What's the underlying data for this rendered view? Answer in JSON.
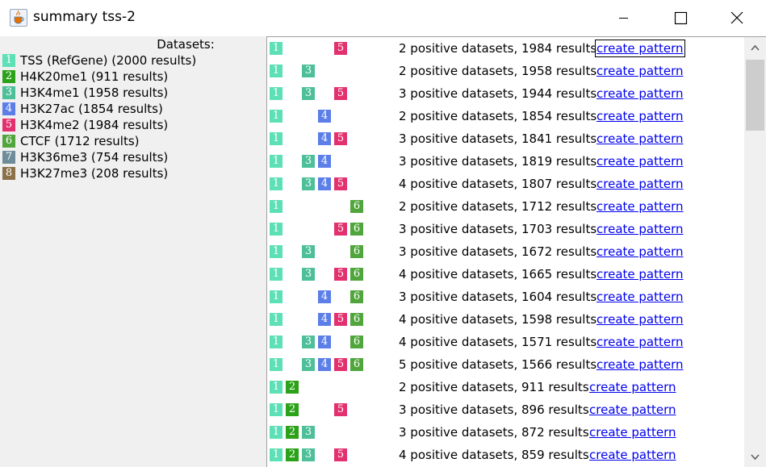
{
  "window": {
    "title": "summary tss-2",
    "icon": "java-cup-icon",
    "controls": {
      "minimize": "minimize-icon",
      "maximize": "maximize-icon",
      "close": "close-icon"
    }
  },
  "datasets": {
    "header": "Datasets:",
    "items": [
      {
        "num": "1",
        "label": "TSS (RefGene) (2000 results)",
        "color": "#5ee0b6"
      },
      {
        "num": "2",
        "label": "H4K20me1 (911 results)",
        "color": "#2ca21a"
      },
      {
        "num": "3",
        "label": "H3K4me1 (1958 results)",
        "color": "#4dbf99"
      },
      {
        "num": "4",
        "label": "H3K27ac (1854 results)",
        "color": "#5b7ee8"
      },
      {
        "num": "5",
        "label": "H3K4me2 (1984 results)",
        "color": "#e2316e"
      },
      {
        "num": "6",
        "label": "CTCF (1712 results)",
        "color": "#50a63c"
      },
      {
        "num": "7",
        "label": "H3K36me3 (754 results)",
        "color": "#6f8c9b"
      },
      {
        "num": "8",
        "label": "H3K27me3 (208 results)",
        "color": "#8c7048"
      }
    ]
  },
  "results": {
    "link_label": "create pattern",
    "rows": [
      {
        "chips": [
          "1",
          "5"
        ],
        "text": "2 positive datasets, 1984 results"
      },
      {
        "chips": [
          "1",
          "3"
        ],
        "text": "2 positive datasets, 1958 results"
      },
      {
        "chips": [
          "1",
          "3",
          "5"
        ],
        "text": "3 positive datasets, 1944 results"
      },
      {
        "chips": [
          "1",
          "4"
        ],
        "text": "2 positive datasets, 1854 results"
      },
      {
        "chips": [
          "1",
          "4",
          "5"
        ],
        "text": "3 positive datasets, 1841 results"
      },
      {
        "chips": [
          "1",
          "3",
          "4"
        ],
        "text": "3 positive datasets, 1819 results"
      },
      {
        "chips": [
          "1",
          "3",
          "4",
          "5"
        ],
        "text": "4 positive datasets, 1807 results"
      },
      {
        "chips": [
          "1",
          "6"
        ],
        "text": "2 positive datasets, 1712 results"
      },
      {
        "chips": [
          "1",
          "5",
          "6"
        ],
        "text": "3 positive datasets, 1703 results"
      },
      {
        "chips": [
          "1",
          "3",
          "6"
        ],
        "text": "3 positive datasets, 1672 results"
      },
      {
        "chips": [
          "1",
          "3",
          "5",
          "6"
        ],
        "text": "4 positive datasets, 1665 results"
      },
      {
        "chips": [
          "1",
          "4",
          "6"
        ],
        "text": "3 positive datasets, 1604 results"
      },
      {
        "chips": [
          "1",
          "4",
          "5",
          "6"
        ],
        "text": "4 positive datasets, 1598 results"
      },
      {
        "chips": [
          "1",
          "3",
          "4",
          "6"
        ],
        "text": "4 positive datasets, 1571 results"
      },
      {
        "chips": [
          "1",
          "3",
          "4",
          "5",
          "6"
        ],
        "text": "5 positive datasets, 1566 results"
      },
      {
        "chips": [
          "1",
          "2"
        ],
        "text": "2 positive datasets, 911 results"
      },
      {
        "chips": [
          "1",
          "2",
          "5"
        ],
        "text": "3 positive datasets, 896 results"
      },
      {
        "chips": [
          "1",
          "2",
          "3"
        ],
        "text": "3 positive datasets, 872 results"
      },
      {
        "chips": [
          "1",
          "2",
          "3",
          "5"
        ],
        "text": "4 positive datasets, 859 results"
      }
    ]
  },
  "scrollbar": {
    "up_icon": "scroll-up-arrow-icon",
    "down_icon": "scroll-down-arrow-icon"
  }
}
